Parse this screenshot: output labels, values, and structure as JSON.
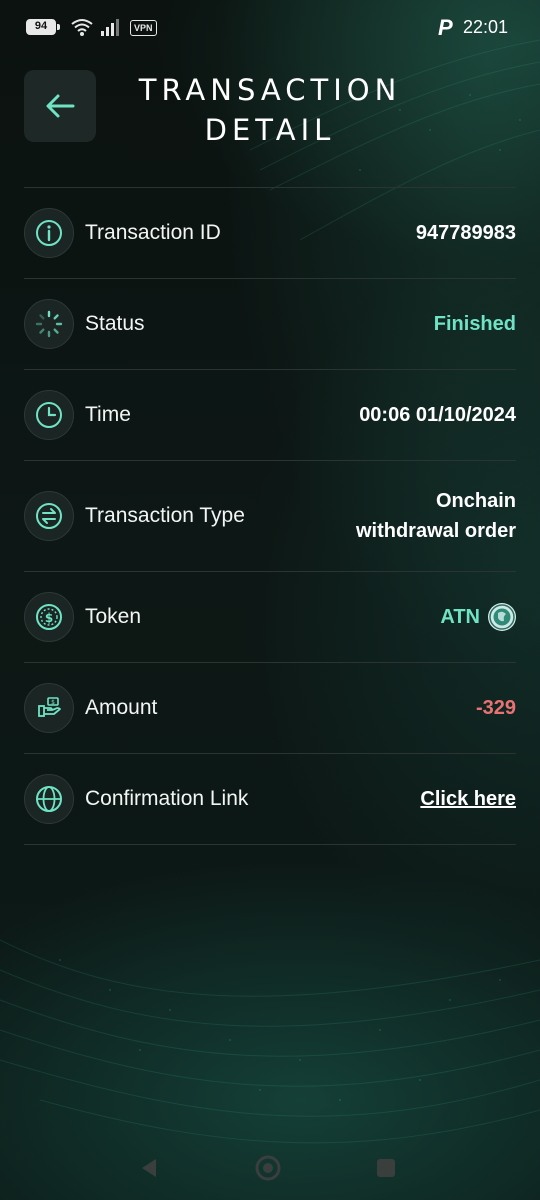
{
  "status_bar": {
    "battery": "94",
    "vpn": "VPN",
    "time": "22:01",
    "app_indicator": "P"
  },
  "header": {
    "title_line1": "TRANSACTION",
    "title_line2": "DETAIL",
    "back_icon": "arrow-left-icon"
  },
  "rows": [
    {
      "label": "Transaction ID",
      "value": "947789983",
      "icon": "info-icon"
    },
    {
      "label": "Status",
      "value": "Finished",
      "icon": "loading-spinner-icon"
    },
    {
      "label": "Time",
      "value": "00:06 01/10/2024",
      "icon": "clock-icon"
    },
    {
      "label": "Transaction Type",
      "value_line1": "Onchain",
      "value_line2": "withdrawal order",
      "icon": "swap-arrows-icon"
    },
    {
      "label": "Token",
      "value": "ATN",
      "icon": "dollar-coin-icon",
      "token_logo": "atn-token-icon"
    },
    {
      "label": "Amount",
      "value": "-329",
      "icon": "hand-money-icon"
    },
    {
      "label": "Confirmation Link",
      "value": "Click here",
      "icon": "globe-icon"
    }
  ],
  "colors": {
    "accent": "#6fe3c4",
    "negative": "#ea7272",
    "background": "#0c1412"
  },
  "nav": {
    "back": "triangle-back-icon",
    "home": "circle-home-icon",
    "recents": "square-recents-icon"
  }
}
